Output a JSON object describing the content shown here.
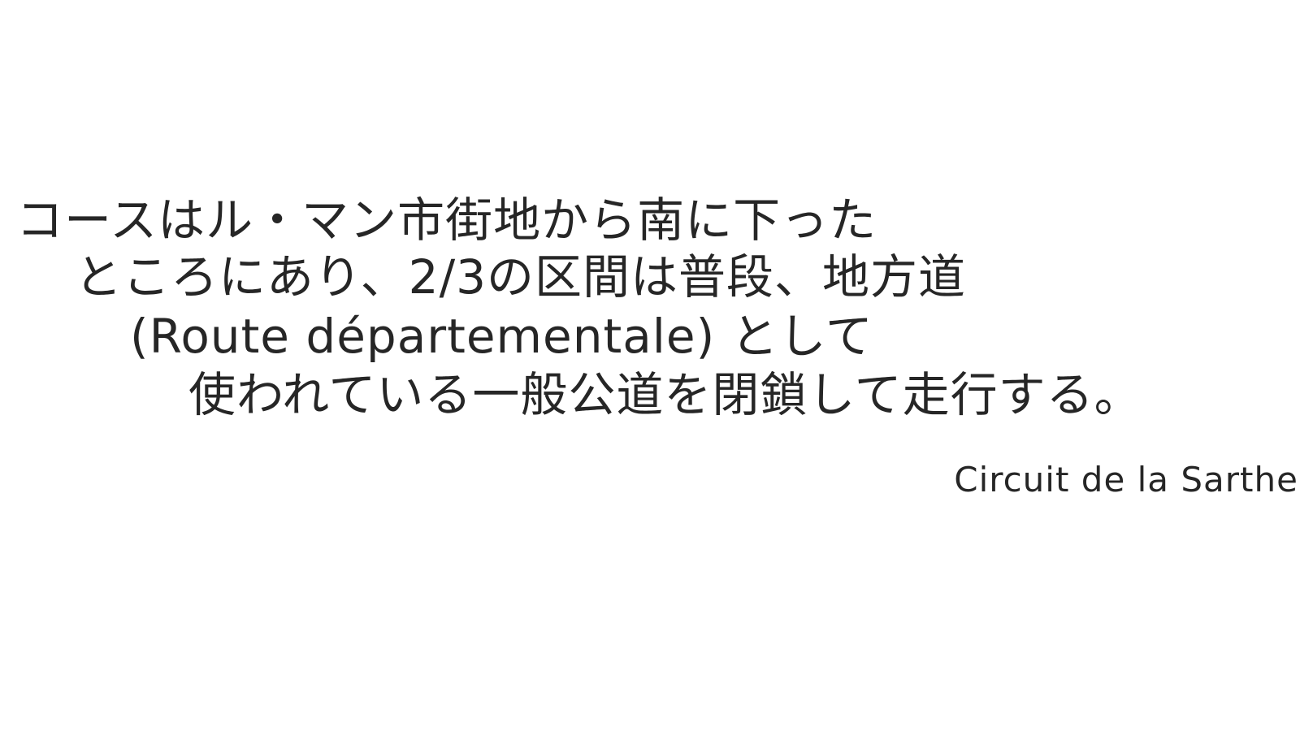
{
  "quote": {
    "lines": [
      "コースはル・マン市街地から南に下った",
      "ところにあり、2/3の区間は普段、地方道",
      "(Route départementale) として",
      "使われている一般公道を閉鎖して走行する。"
    ]
  },
  "source": "Circuit de la Sarthe"
}
